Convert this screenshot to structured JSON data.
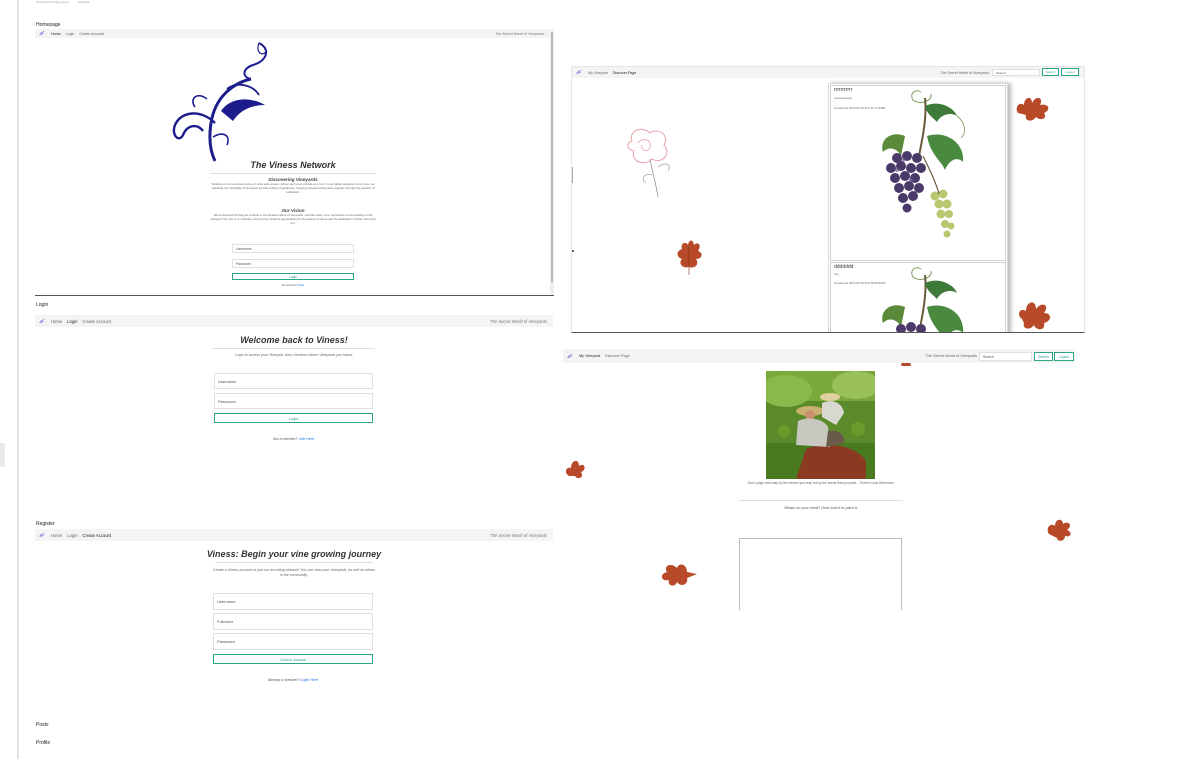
{
  "top_strip": {
    "text_a": "Viness Home Page Layout",
    "text_b": "Select all"
  },
  "labels": {
    "homepage": "Homepage",
    "login": "Login",
    "register": "Register",
    "posts": "Posts",
    "profile": "Profile"
  },
  "nav_guest": {
    "home": "Home",
    "login": "Login",
    "create": "Create Account",
    "brand": "The Secret World of Vineyards"
  },
  "nav_user": {
    "my_vineyard": "My Vineyard",
    "discover": "Discover Page",
    "brand": "The Secret World of Vineyards",
    "search_placeholder": "Search",
    "search_btn": "Search",
    "logout_btn": "Logout"
  },
  "homepage": {
    "title": "The Viness Network",
    "sec1_title": "Discovering Vineyards",
    "sec1_text": "Welcome to our exclusive grove of vines and vinears, where each post unfolds as a 'vine' in our digital vineyard. At our core, we celebrate the tranquility of vineyards and the artistry of gardening, bringing vineyard enthusiasts together through the passion of cultivation.",
    "sec2_title": "Our Vision",
    "sec2_text": "We envisioned this blog as a tribute to the timeless allure of vineyards. Just like every 'vine' represents a new seedling in the vineyard. Our aim is to cultivate a community rooted in appreciation for the beauty of nature and the dedication of those who tend to it.",
    "username_ph": "Username",
    "password_ph": "Password",
    "login_btn": "Login",
    "register_prompt": "No account?",
    "register_link": "Start"
  },
  "login": {
    "title": "Welcome back to Viness!",
    "subtitle": "Login to access your Vineyard. Also checkout others Vineyards you follow.",
    "username_ph": "Username",
    "password_ph": "Password",
    "login_btn": "Login",
    "prompt": "Not a member?",
    "link": "Join Here"
  },
  "register": {
    "title": "Viness: Begin your vine growing journey",
    "subtitle": "Create a Viness account to join our recruiting network! You can view your Vineyards, as well as others in the community.",
    "username_ph": "Username",
    "fullname_ph": "Fullname",
    "password_ph": "Password",
    "btn": "Unlock Access",
    "prompt": "Already a member?",
    "link": "Login Here"
  },
  "discover": {
    "cards": [
      {
        "title": "rrrrrrrrrrr",
        "body": "ssssssssssss",
        "created": "Created at 2024-05-10T12:17:17.598Z"
      },
      {
        "title": "ddddddd",
        "body": "hey",
        "created": "Created at 2024-05-10T12:20:20.504Z"
      }
    ]
  },
  "profile": {
    "quote": "Don't judge each day by the harvest you reap but by the seeds that you plant. - Robert Louis Stevenson",
    "prompt": "Whats on your mind? Dont hold it in plant it:"
  },
  "colors": {
    "accent": "#2aa58a",
    "logo_navy": "#1c1c8c",
    "leaf": "#b84a2a",
    "grape": "#4a3a6a",
    "vine_leaf": "#3e7a3a"
  }
}
